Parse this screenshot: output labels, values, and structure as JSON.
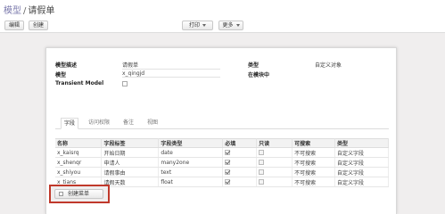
{
  "breadcrumb": {
    "parent": "模型",
    "separator": "/",
    "current": "请假单"
  },
  "toolbar": {
    "edit": "编辑",
    "create": "创建",
    "print": "打印",
    "more": "更多"
  },
  "form": {
    "description_label": "模型描述",
    "description_value": "请假单",
    "model_label": "模型",
    "model_value": "x_qingjd",
    "transient_label": "Transient Model",
    "transient_checked": false,
    "type_label": "类型",
    "type_value": "自定义对象",
    "in_module_label": "在模块中",
    "in_module_value": ""
  },
  "tabs": [
    "字段",
    "访问权限",
    "备注",
    "视图"
  ],
  "table": {
    "headers": [
      "名称",
      "字段标签",
      "字段类型",
      "必填",
      "只读",
      "可搜索",
      "类型"
    ],
    "rows": [
      {
        "name": "x_kaisrq",
        "label": "开始日期",
        "type": "date",
        "required": true,
        "readonly": false,
        "searchable": "不可搜索",
        "kind": "自定义字段"
      },
      {
        "name": "x_shenqr",
        "label": "申请人",
        "type": "many2one",
        "required": true,
        "readonly": false,
        "searchable": "不可搜索",
        "kind": "自定义字段"
      },
      {
        "name": "x_shiyou",
        "label": "请假事由",
        "type": "text",
        "required": true,
        "readonly": false,
        "searchable": "不可搜索",
        "kind": "自定义字段"
      },
      {
        "name": "x_tians",
        "label": "请假天数",
        "type": "float",
        "required": true,
        "readonly": false,
        "searchable": "不可搜索",
        "kind": "自定义字段"
      }
    ]
  },
  "create_menu_label": "创建菜单"
}
